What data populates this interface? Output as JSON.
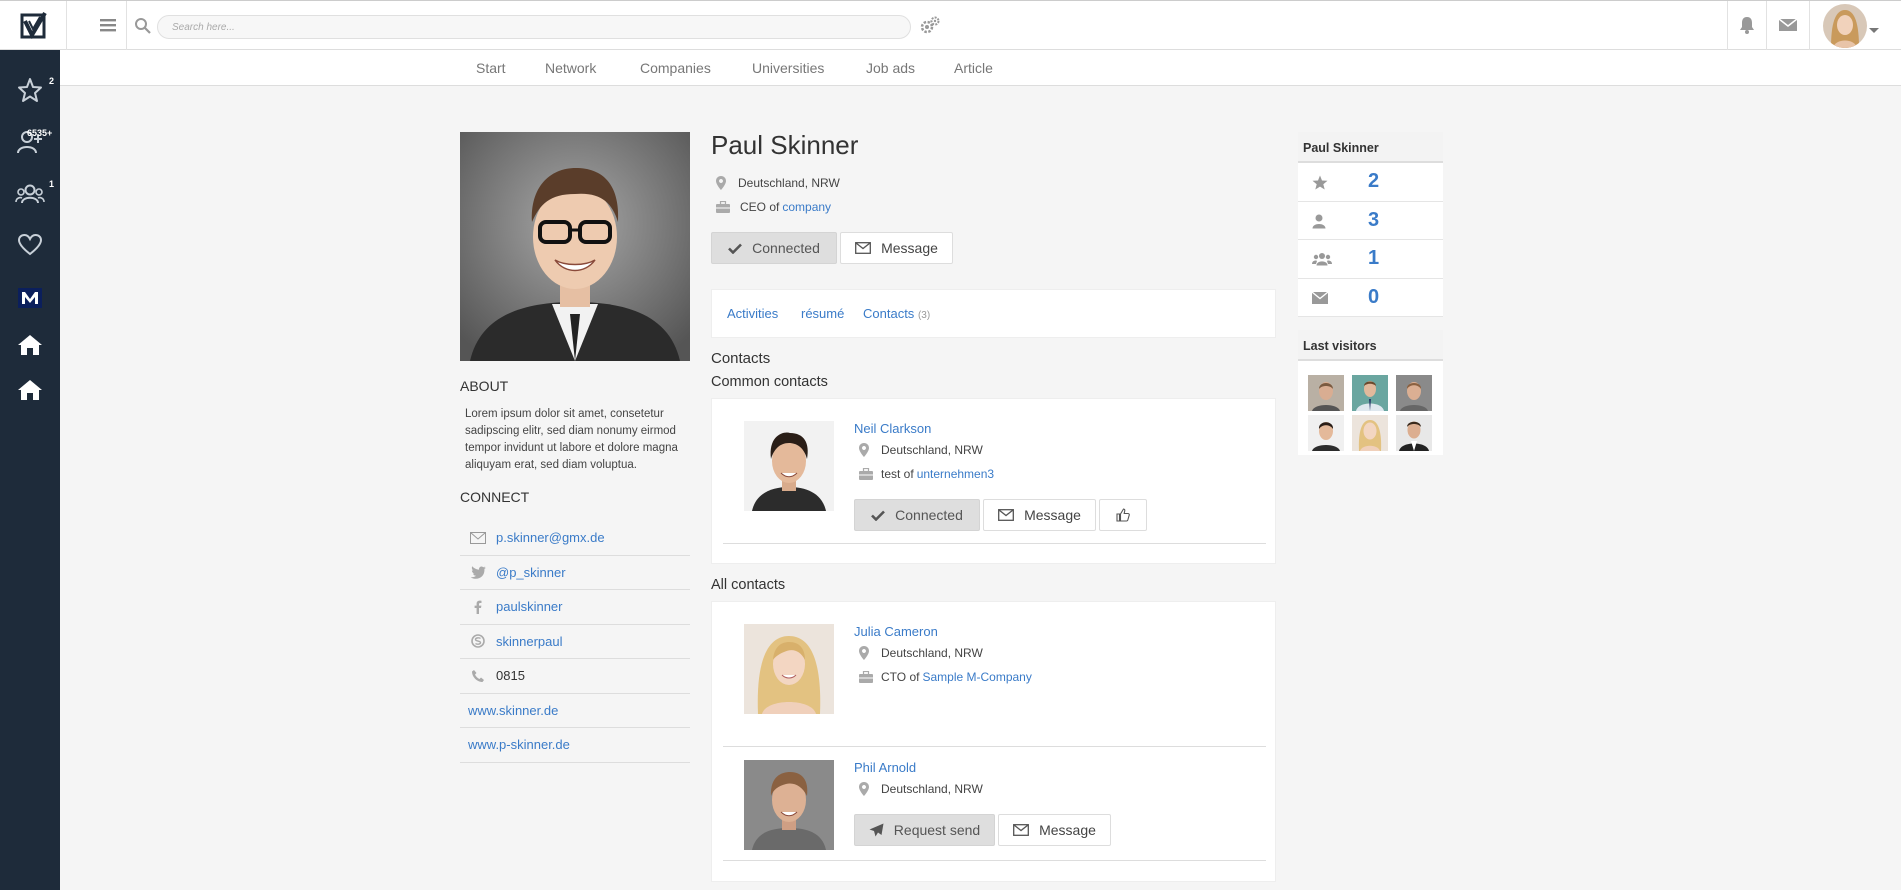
{
  "search": {
    "placeholder": "Search here..."
  },
  "sidebar": {
    "badges": {
      "favorites": "2",
      "connection_requests": "6535+",
      "groups": "1"
    }
  },
  "nav": {
    "items": [
      {
        "label": "Start"
      },
      {
        "label": "Network"
      },
      {
        "label": "Companies"
      },
      {
        "label": "Universities"
      },
      {
        "label": "Job ads"
      },
      {
        "label": "Article"
      }
    ]
  },
  "profile": {
    "name": "Paul Skinner",
    "location": "Deutschland, NRW",
    "position_prefix": "CEO of",
    "company": "company",
    "connected_label": "Connected",
    "message_label": "Message",
    "about_title": "ABOUT",
    "about_text": "Lorem ipsum dolor sit amet, consetetur sadipscing elitr, sed diam nonumy eirmod tempor invidunt ut labore et dolore magna aliquyam erat, sed diam voluptua.",
    "connect_title": "CONNECT",
    "email": "p.skinner@gmx.de",
    "twitter": "@p_skinner",
    "facebook": "paulskinner",
    "skype": "skinnerpaul",
    "phone": "0815",
    "website1": "www.skinner.de",
    "website2": "www.p-skinner.de"
  },
  "tabs": {
    "activities": "Activities",
    "resume": "résumé",
    "contacts": "Contacts",
    "contacts_count": "(3)"
  },
  "contacts": {
    "heading": "Contacts",
    "common_heading": "Common contacts",
    "all_heading": "All contacts",
    "common": [
      {
        "name": "Neil Clarkson",
        "location": "Deutschland, NRW",
        "position_prefix": "test of",
        "company": "unternehmen3",
        "connected_label": "Connected",
        "message_label": "Message"
      }
    ],
    "all": [
      {
        "name": "Julia Cameron",
        "location": "Deutschland, NRW",
        "position_prefix": "CTO of",
        "company": "Sample M-Company"
      },
      {
        "name": "Phil Arnold",
        "location": "Deutschland, NRW",
        "request_label": "Request send",
        "message_label": "Message"
      }
    ]
  },
  "stats": {
    "title": "Paul Skinner",
    "favorites": "2",
    "contacts": "3",
    "groups": "1",
    "messages": "0"
  },
  "visitors": {
    "title": "Last visitors"
  },
  "colors": {
    "accent": "#3a7bc8",
    "sidebar": "#1e2b3a"
  }
}
